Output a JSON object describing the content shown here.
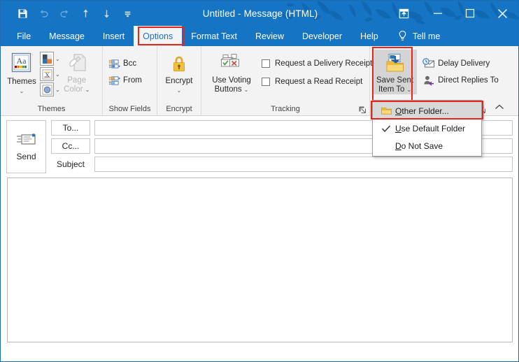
{
  "window": {
    "title": "Untitled  -  Message (HTML)",
    "accent_color": "#1574c4",
    "annotation_color": "#e8231a"
  },
  "quick_access": {
    "items": [
      {
        "name": "save-icon",
        "label": "Save"
      },
      {
        "name": "undo-icon",
        "label": "Undo"
      },
      {
        "name": "redo-icon",
        "label": "Redo"
      },
      {
        "name": "previous-item-icon",
        "label": "Previous Item"
      },
      {
        "name": "next-item-icon",
        "label": "Next Item"
      },
      {
        "name": "customize-quick-access-toolbar-icon",
        "label": "Customize Quick Access Toolbar"
      }
    ]
  },
  "window_controls": {
    "ribbon_display_options": "Ribbon Display Options",
    "minimize": "Minimize",
    "maximize": "Maximize",
    "close": "Close"
  },
  "tabs": [
    {
      "label": "File",
      "active": false
    },
    {
      "label": "Message",
      "active": false
    },
    {
      "label": "Insert",
      "active": false
    },
    {
      "label": "Options",
      "active": true
    },
    {
      "label": "Format Text",
      "active": false
    },
    {
      "label": "Review",
      "active": false
    },
    {
      "label": "Developer",
      "active": false
    },
    {
      "label": "Help",
      "active": false
    }
  ],
  "tell_me": {
    "label": "Tell me",
    "icon": "lightbulb-icon"
  },
  "ribbon": {
    "groups": [
      {
        "name": "themes",
        "label": "Themes",
        "themes_button": "Themes",
        "page_color_button": "Page\nColor",
        "page_color_line1": "Page",
        "page_color_line2": "Color",
        "mini_buttons": [
          {
            "name": "theme-colors-button",
            "label": "Colors"
          },
          {
            "name": "theme-fonts-button",
            "label": "Fonts"
          },
          {
            "name": "theme-effects-button",
            "label": "Effects"
          }
        ]
      },
      {
        "name": "show-fields",
        "label": "Show Fields",
        "items": [
          {
            "name": "bcc-button",
            "label": "Bcc"
          },
          {
            "name": "from-button",
            "label": "From"
          }
        ]
      },
      {
        "name": "encrypt",
        "label": "Encrypt",
        "encrypt_button": "Encrypt"
      },
      {
        "name": "tracking",
        "label": "Tracking",
        "use_voting_line1": "Use Voting",
        "use_voting_line2": "Buttons",
        "checkboxes": [
          {
            "name": "request-delivery-receipt-checkbox",
            "label": "Request a Delivery Receipt",
            "checked": false
          },
          {
            "name": "request-read-receipt-checkbox",
            "label": "Request a Read Receipt",
            "checked": false
          }
        ]
      },
      {
        "name": "more-options",
        "label": "",
        "save_sent_item_line1": "Save Sent",
        "save_sent_item_line2": "Item To",
        "items": [
          {
            "name": "delay-delivery-button",
            "label": "Delay Delivery"
          },
          {
            "name": "direct-replies-to-button",
            "label": "Direct Replies To"
          }
        ]
      }
    ],
    "collapse_label": "Collapse the Ribbon"
  },
  "save_sent_item_menu": {
    "items": [
      {
        "name": "menu-item-other-folder",
        "prefix": "",
        "accel": "O",
        "rest": "ther Folder...",
        "icon": "folder-icon",
        "checked": false,
        "highlighted": true
      },
      {
        "name": "menu-item-use-default-folder",
        "prefix": "",
        "accel": "U",
        "rest": "se Default Folder",
        "icon": "check-icon",
        "checked": true,
        "highlighted": false
      },
      {
        "name": "menu-item-do-not-save",
        "prefix": "",
        "accel": "D",
        "rest": "o Not Save",
        "icon": "",
        "checked": false,
        "highlighted": false
      }
    ]
  },
  "compose": {
    "send_button": "Send",
    "to_button": "To...",
    "cc_button": "Cc...",
    "subject_label": "Subject",
    "to_value": "",
    "cc_value": "",
    "subject_value": "",
    "body_value": ""
  }
}
